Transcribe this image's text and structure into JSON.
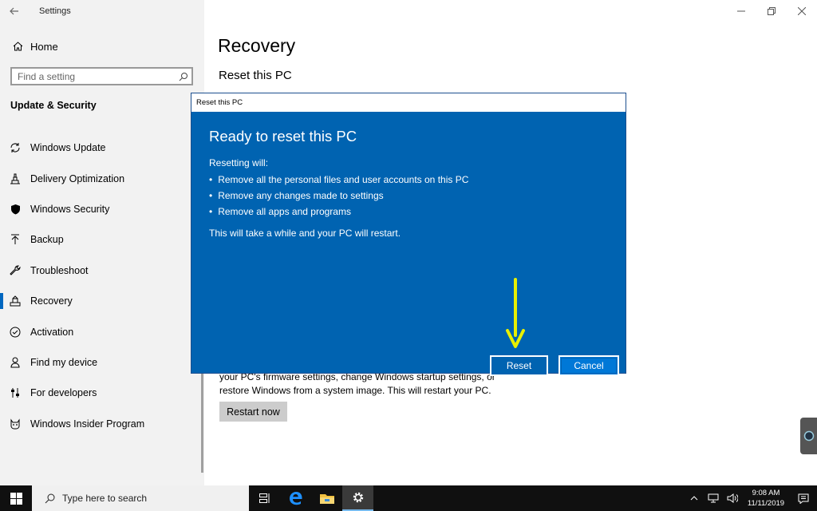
{
  "app": {
    "title": "Settings"
  },
  "sidebar": {
    "home_label": "Home",
    "search_placeholder": "Find a setting",
    "section_title": "Update & Security",
    "items": [
      {
        "label": "Windows Update",
        "icon": "sync-icon"
      },
      {
        "label": "Delivery Optimization",
        "icon": "delivery-optimization-icon"
      },
      {
        "label": "Windows Security",
        "icon": "shield-icon"
      },
      {
        "label": "Backup",
        "icon": "backup-arrow-icon"
      },
      {
        "label": "Troubleshoot",
        "icon": "wrench-icon"
      },
      {
        "label": "Recovery",
        "icon": "recovery-icon",
        "active": true
      },
      {
        "label": "Activation",
        "icon": "check-circle-icon"
      },
      {
        "label": "Find my device",
        "icon": "person-pin-icon"
      },
      {
        "label": "For developers",
        "icon": "developer-sliders-icon"
      },
      {
        "label": "Windows Insider Program",
        "icon": "insider-cat-icon"
      }
    ]
  },
  "main": {
    "title": "Recovery",
    "subtitle": "Reset this PC",
    "advanced_text": "your PC's firmware settings, change Windows startup settings, or restore Windows from a system image. This will restart your PC.",
    "restart_button": "Restart now"
  },
  "dialog": {
    "window_title": "Reset this PC",
    "heading": "Ready to reset this PC",
    "intro": "Resetting will:",
    "bullets": [
      "Remove all the personal files and user accounts on this PC",
      "Remove any changes made to settings",
      "Remove all apps and programs"
    ],
    "note": "This will take a while and your PC will restart.",
    "reset_button": "Reset",
    "cancel_button": "Cancel"
  },
  "taskbar": {
    "search_placeholder": "Type here to search",
    "time": "9:08 AM",
    "date": "11/11/2019"
  },
  "colors": {
    "dialog_bg": "#0063b1",
    "accent": "#0078d7",
    "annotation_arrow": "#e8f000"
  }
}
